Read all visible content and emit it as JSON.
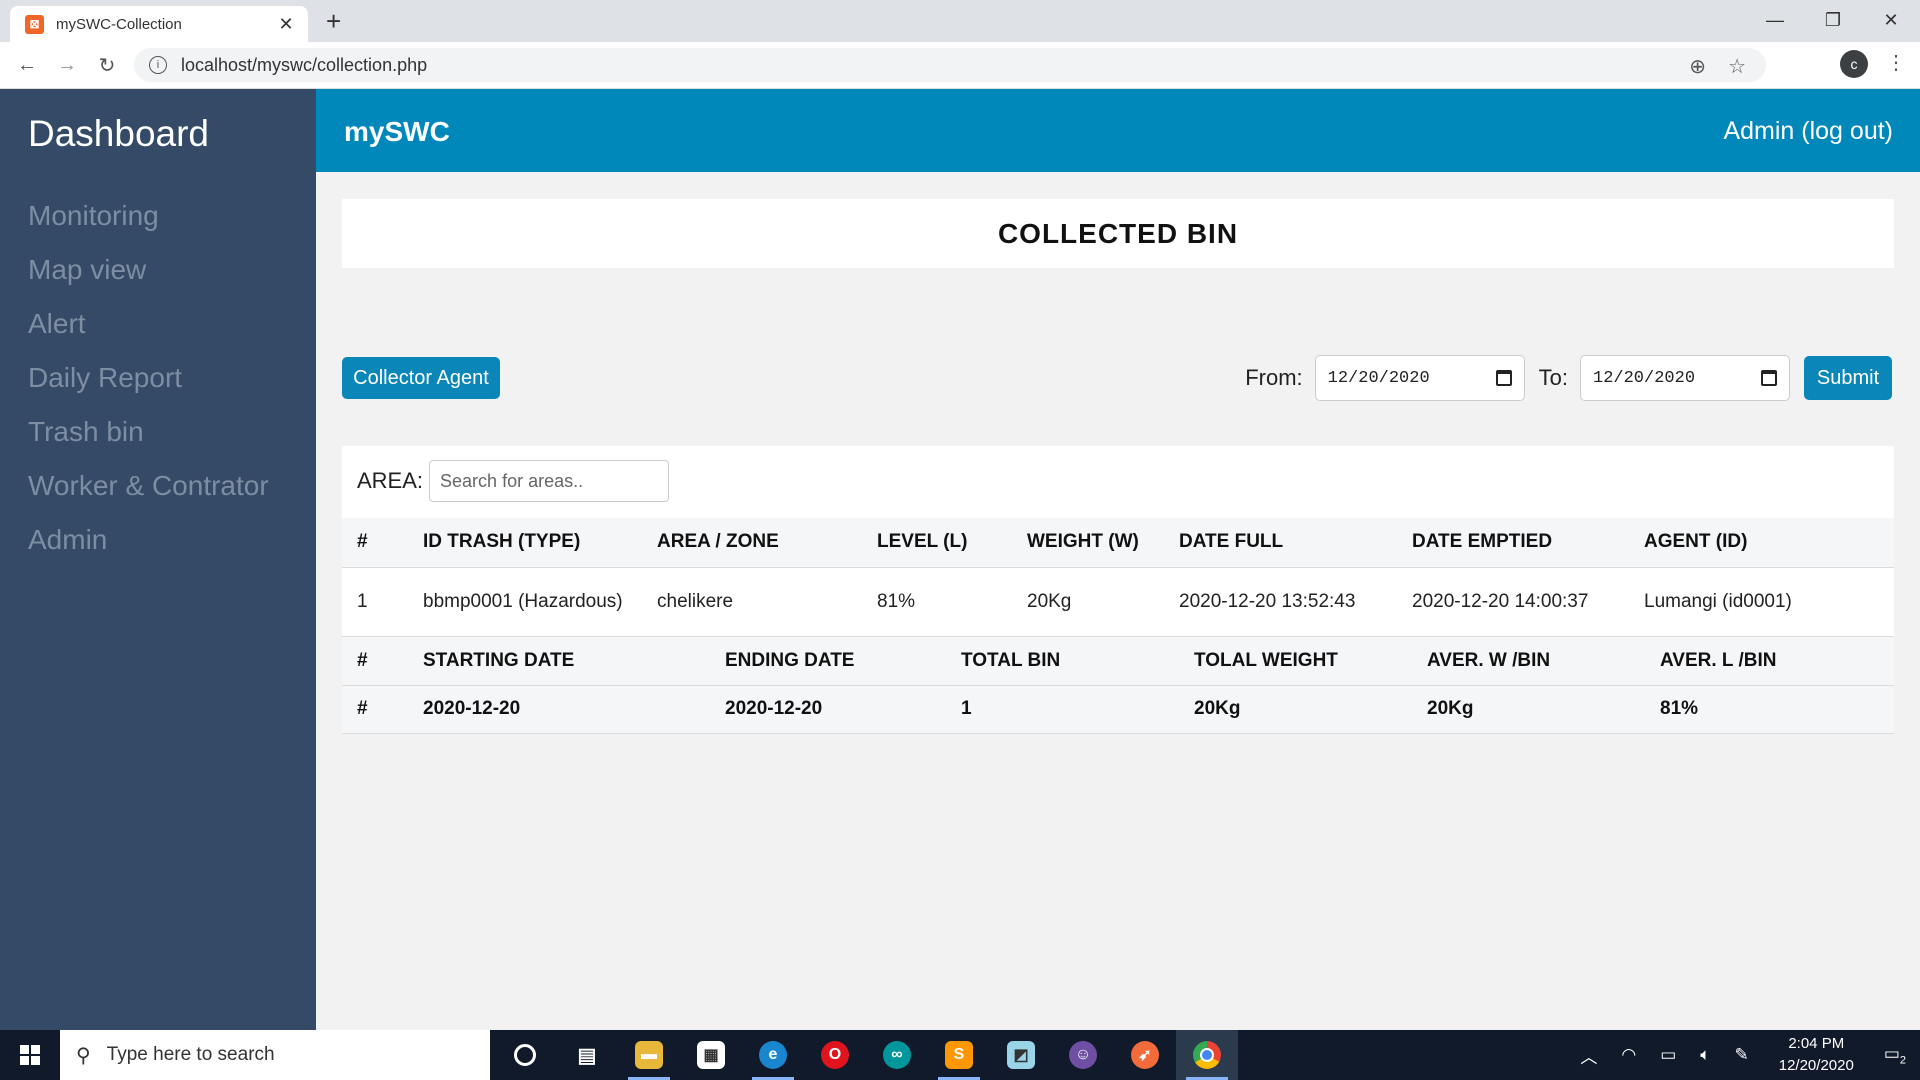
{
  "browser": {
    "tab_title": "mySWC-Collection",
    "tab_close": "✕",
    "new_tab": "+",
    "url": "localhost/myswc/collection.php",
    "profile_initial": "c",
    "window_controls": [
      "—",
      "❐",
      "✕"
    ]
  },
  "sidebar": {
    "title": "Dashboard",
    "items": [
      {
        "label": "Monitoring"
      },
      {
        "label": "Map view"
      },
      {
        "label": "Alert"
      },
      {
        "label": "Daily Report"
      },
      {
        "label": "Trash bin"
      },
      {
        "label": "Worker & Contrator"
      },
      {
        "label": "Admin"
      }
    ]
  },
  "header": {
    "brand": "mySWC",
    "logout": "Admin (log out)"
  },
  "main": {
    "title": "COLLECTED BIN",
    "collector_button": "Collector Agent",
    "filter": {
      "from_label": "From:",
      "from_value": "12/20/2020",
      "to_label": "To:",
      "to_value": "12/20/2020",
      "submit": "Submit"
    },
    "area": {
      "label": "AREA:",
      "placeholder": "Search for areas.."
    },
    "table": {
      "headers": [
        "#",
        "ID TRASH (TYPE)",
        "AREA / ZONE",
        "LEVEL (L)",
        "WEIGHT (W)",
        "DATE FULL",
        "DATE EMPTIED",
        "AGENT (ID)"
      ],
      "rows": [
        [
          "1",
          "bbmp0001 (Hazardous)",
          "chelikere",
          "81%",
          "20Kg",
          "2020-12-20 13:52:43",
          "2020-12-20 14:00:37",
          "Lumangi (id0001)"
        ]
      ]
    },
    "summary": {
      "headers": [
        "#",
        "STARTING DATE",
        "ENDING DATE",
        "TOTAL BIN",
        "TOLAL WEIGHT",
        "AVER. W /BIN",
        "AVER. L /BIN"
      ],
      "values": [
        "#",
        "2020-12-20",
        "2020-12-20",
        "1",
        "20Kg",
        "20Kg",
        "81%"
      ]
    }
  },
  "taskbar": {
    "search_placeholder": "Type here to search",
    "time": "2:04 PM",
    "date": "12/20/2020",
    "notification_count": "2",
    "apps": [
      {
        "icon": "cortana-icon",
        "color": "#101a2a"
      },
      {
        "icon": "task-view-icon",
        "color": "#101a2a"
      },
      {
        "icon": "file-explorer-icon",
        "color": "#e8b83a"
      },
      {
        "icon": "store-icon",
        "color": "#ffffff"
      },
      {
        "icon": "edge-icon",
        "color": "#1a86d0"
      },
      {
        "icon": "opera-icon",
        "color": "#e0141e"
      },
      {
        "icon": "arduino-icon",
        "color": "#00979c"
      },
      {
        "icon": "sublime-icon",
        "color": "#ff9800"
      },
      {
        "icon": "notes-icon",
        "color": "#9ad4e8"
      },
      {
        "icon": "github-icon",
        "color": "#6e4fa3"
      },
      {
        "icon": "postman-icon",
        "color": "#f26b3a"
      },
      {
        "icon": "chrome-icon",
        "color": "#4285f4"
      }
    ]
  }
}
